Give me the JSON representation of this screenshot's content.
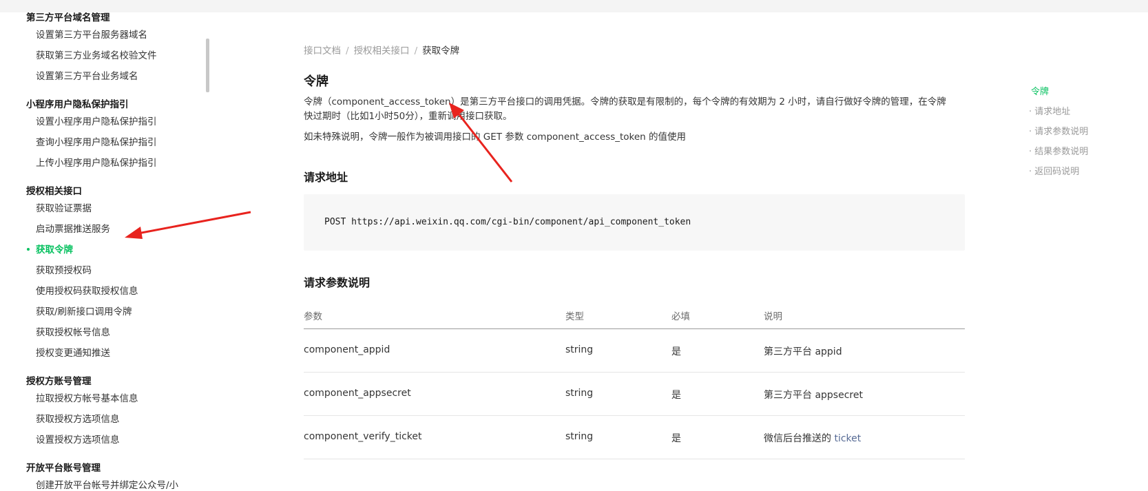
{
  "sidebar": {
    "groups": [
      {
        "title": "第三方平台域名管理",
        "items": [
          "设置第三方平台服务器域名",
          "获取第三方业务域名校验文件",
          "设置第三方平台业务域名"
        ]
      },
      {
        "title": "小程序用户隐私保护指引",
        "items": [
          "设置小程序用户隐私保护指引",
          "查询小程序用户隐私保护指引",
          "上传小程序用户隐私保护指引"
        ]
      },
      {
        "title": "授权相关接口",
        "items": [
          "获取验证票据",
          "启动票据推送服务",
          "获取令牌",
          "获取预授权码",
          "使用授权码获取授权信息",
          "获取/刷新接口调用令牌",
          "获取授权帐号信息",
          "授权变更通知推送"
        ]
      },
      {
        "title": "授权方账号管理",
        "items": [
          "拉取授权方帐号基本信息",
          "获取授权方选项信息",
          "设置授权方选项信息"
        ]
      },
      {
        "title": "开放平台账号管理",
        "items": [
          "创建开放平台帐号并绑定公众号/小"
        ]
      }
    ],
    "active_item": "获取令牌"
  },
  "breadcrumb": {
    "items": [
      "接口文档",
      "授权相关接口",
      "获取令牌"
    ],
    "separator": "/"
  },
  "content": {
    "title": "令牌",
    "para1_line1": "令牌（component_access_token）是第三方平台接口的调用凭据。令牌的获取是有限制的，每个令牌的有效期为 2 小时，请自行做好令牌的管理，在令牌",
    "para1_line2": "快过期时（比如1小时50分），重新调用接口获取。",
    "para2": "如未特殊说明，令牌一般作为被调用接口的 GET 参数 component_access_token 的值使用",
    "request_url_title": "请求地址",
    "request_url": "POST https://api.weixin.qq.com/cgi-bin/component/api_component_token",
    "params_title": "请求参数说明",
    "table": {
      "headers": [
        "参数",
        "类型",
        "必填",
        "说明"
      ],
      "rows": [
        {
          "param": "component_appid",
          "type": "string",
          "required": "是",
          "desc": "第三方平台 appid",
          "desc_link": ""
        },
        {
          "param": "component_appsecret",
          "type": "string",
          "required": "是",
          "desc": "第三方平台 appsecret",
          "desc_link": ""
        },
        {
          "param": "component_verify_ticket",
          "type": "string",
          "required": "是",
          "desc": "微信后台推送的 ",
          "desc_link": "ticket"
        }
      ]
    }
  },
  "toc": {
    "items": [
      "令牌",
      "· 请求地址",
      "· 请求参数说明",
      "· 结果参数说明",
      "· 返回码说明"
    ],
    "active_index": 0
  },
  "colors": {
    "accent": "#07c160",
    "annotation_arrow": "#e8231e",
    "link": "#576b95"
  }
}
